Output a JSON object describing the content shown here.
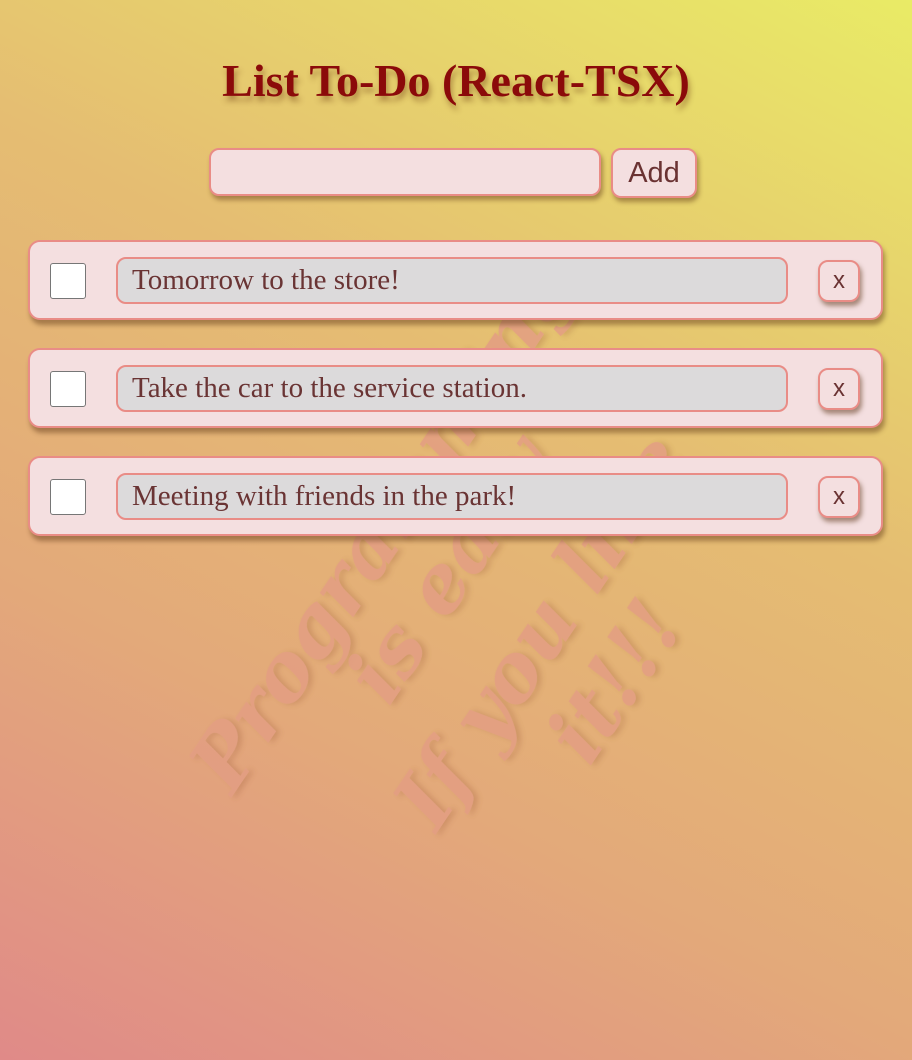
{
  "app": {
    "title": "List To-Do (React-TSX)"
  },
  "add_form": {
    "input_value": "",
    "add_label": "Add"
  },
  "todos": [
    {
      "text": "Tomorrow to the store!",
      "done": false,
      "remove_label": "x"
    },
    {
      "text": "Take the car to the service station.",
      "done": false,
      "remove_label": "x"
    },
    {
      "text": "Meeting with friends in the park!",
      "done": false,
      "remove_label": "x"
    }
  ],
  "watermark": {
    "lines": [
      "Programming",
      "is easy",
      "If you like",
      "it!!!"
    ]
  },
  "colors": {
    "title": "#8b0a0a",
    "border": "#e98c86",
    "panel": "#f4dfe0",
    "text_field": "#dcdadb",
    "text": "#6a3434",
    "watermark": "#e39e83"
  }
}
